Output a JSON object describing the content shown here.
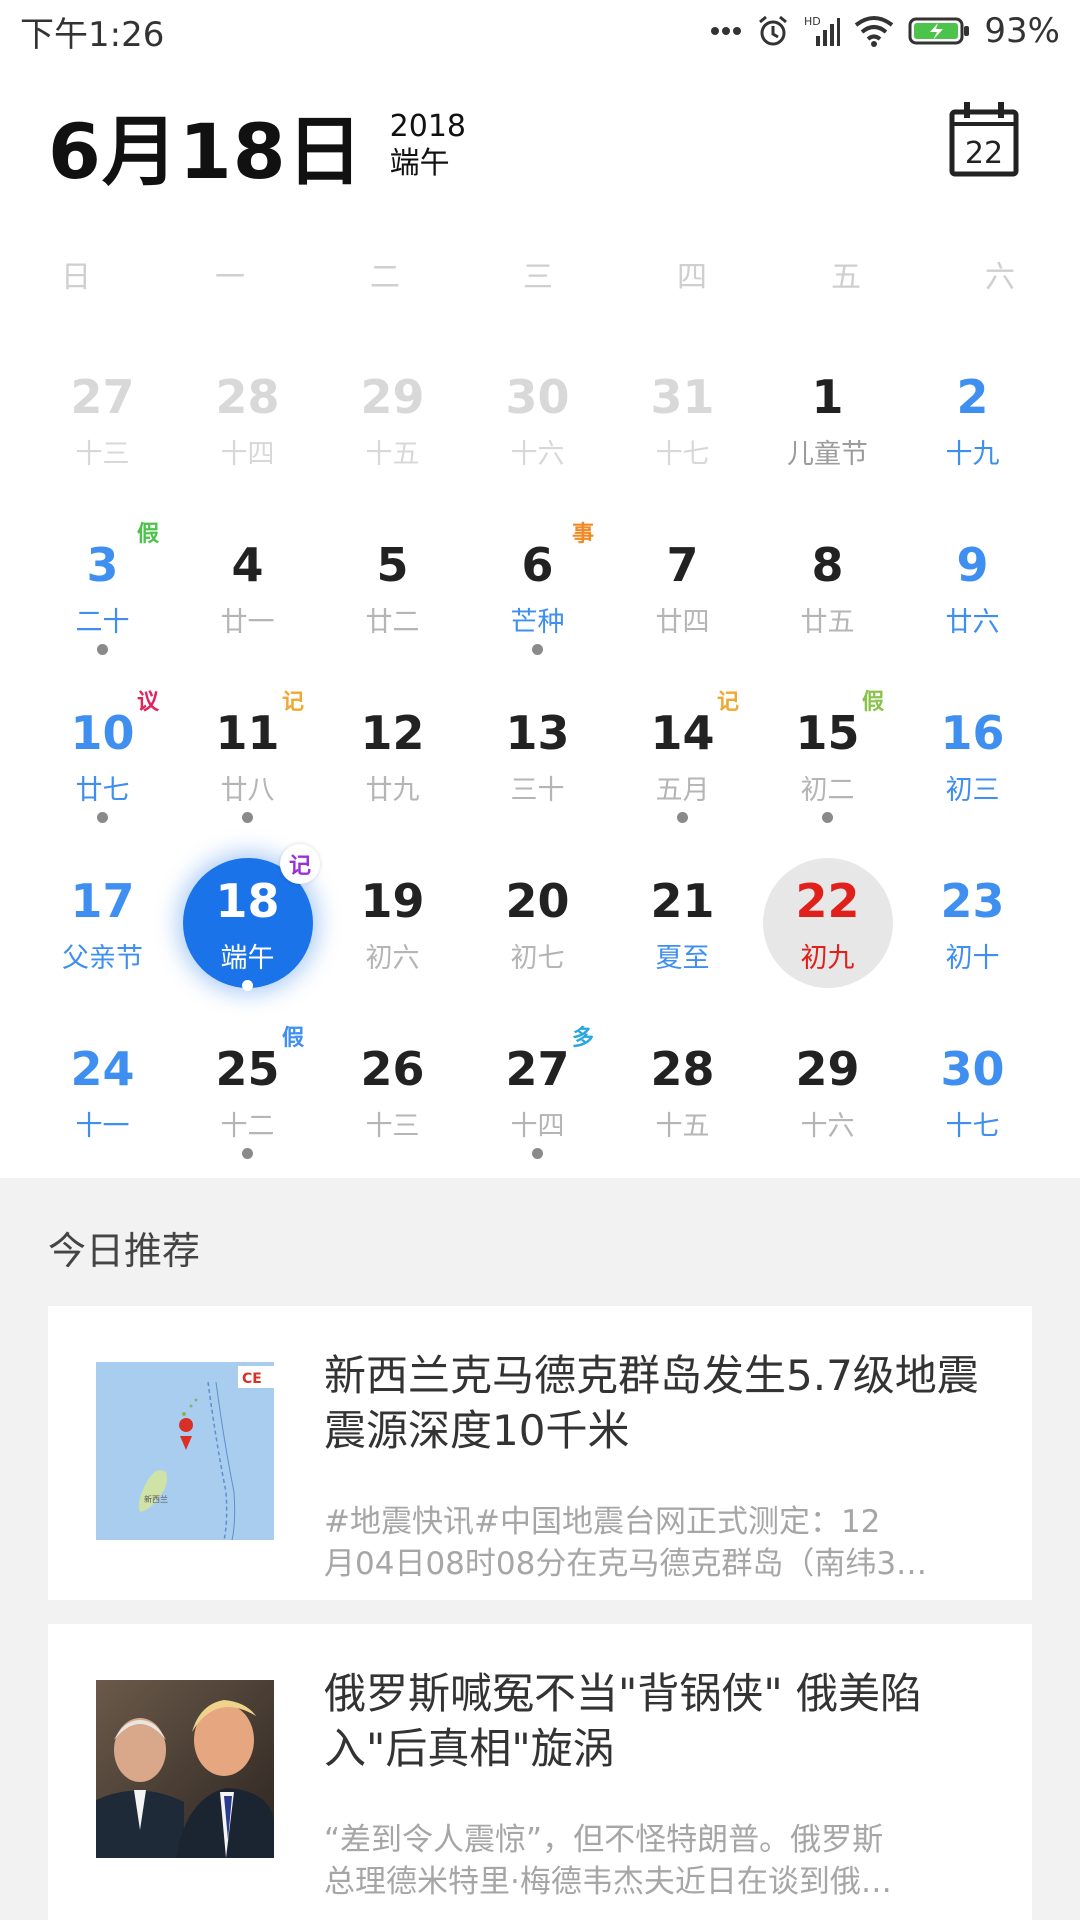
{
  "status_bar": {
    "time": "下午1:26",
    "battery": "93%",
    "icons": [
      "more-dots-icon",
      "alarm-icon",
      "hd-signal-icon",
      "wifi-icon",
      "battery-charging-icon"
    ]
  },
  "header": {
    "date": "6月18日",
    "year": "2018",
    "festival": "端午",
    "today_button_day": "22"
  },
  "weekdays": [
    "日",
    "一",
    "二",
    "三",
    "四",
    "五",
    "六"
  ],
  "calendar": {
    "rows": [
      [
        {
          "day": "27",
          "lunar": "十三",
          "type": "other"
        },
        {
          "day": "28",
          "lunar": "十四",
          "type": "other"
        },
        {
          "day": "29",
          "lunar": "十五",
          "type": "other"
        },
        {
          "day": "30",
          "lunar": "十六",
          "type": "other"
        },
        {
          "day": "31",
          "lunar": "十七",
          "type": "other"
        },
        {
          "day": "1",
          "lunar": "儿童节",
          "type": "holiday-name"
        },
        {
          "day": "2",
          "lunar": "十九",
          "type": "weekend"
        }
      ],
      [
        {
          "day": "3",
          "lunar": "二十",
          "type": "weekend",
          "badge": "假",
          "badge_color": "#4cc34a",
          "dot": true
        },
        {
          "day": "4",
          "lunar": "廿一",
          "type": "normal"
        },
        {
          "day": "5",
          "lunar": "廿二",
          "type": "normal"
        },
        {
          "day": "6",
          "lunar": "芒种",
          "type": "solar",
          "badge": "事",
          "badge_color": "#f08a24",
          "dot": true
        },
        {
          "day": "7",
          "lunar": "廿四",
          "type": "normal"
        },
        {
          "day": "8",
          "lunar": "廿五",
          "type": "normal"
        },
        {
          "day": "9",
          "lunar": "廿六",
          "type": "weekend"
        }
      ],
      [
        {
          "day": "10",
          "lunar": "廿七",
          "type": "weekend",
          "badge": "议",
          "badge_color": "#e0245e",
          "dot": true
        },
        {
          "day": "11",
          "lunar": "廿八",
          "type": "normal",
          "badge": "记",
          "badge_color": "#f0a830",
          "dot": true
        },
        {
          "day": "12",
          "lunar": "廿九",
          "type": "normal"
        },
        {
          "day": "13",
          "lunar": "三十",
          "type": "normal"
        },
        {
          "day": "14",
          "lunar": "五月",
          "type": "normal",
          "badge": "记",
          "badge_color": "#f0a830",
          "dot": true
        },
        {
          "day": "15",
          "lunar": "初二",
          "type": "normal",
          "badge": "假",
          "badge_color": "#8bc34a",
          "dot": true
        },
        {
          "day": "16",
          "lunar": "初三",
          "type": "weekend"
        }
      ],
      [
        {
          "day": "17",
          "lunar": "父亲节",
          "type": "weekend"
        },
        {
          "day": "18",
          "lunar": "端午",
          "type": "selected",
          "badge": "记",
          "badge_color": "#9b30d9",
          "dot": true
        },
        {
          "day": "19",
          "lunar": "初六",
          "type": "normal"
        },
        {
          "day": "20",
          "lunar": "初七",
          "type": "normal"
        },
        {
          "day": "21",
          "lunar": "夏至",
          "type": "solar"
        },
        {
          "day": "22",
          "lunar": "初九",
          "type": "today"
        },
        {
          "day": "23",
          "lunar": "初十",
          "type": "weekend"
        }
      ],
      [
        {
          "day": "24",
          "lunar": "十一",
          "type": "weekend"
        },
        {
          "day": "25",
          "lunar": "十二",
          "type": "normal",
          "badge": "假",
          "badge_color": "#3f8ff0",
          "dot": true
        },
        {
          "day": "26",
          "lunar": "十三",
          "type": "normal"
        },
        {
          "day": "27",
          "lunar": "十四",
          "type": "normal",
          "badge": "多",
          "badge_color": "#2aa7e0",
          "dot": true
        },
        {
          "day": "28",
          "lunar": "十五",
          "type": "normal"
        },
        {
          "day": "29",
          "lunar": "十六",
          "type": "normal"
        },
        {
          "day": "30",
          "lunar": "十七",
          "type": "weekend"
        }
      ]
    ]
  },
  "recommend": {
    "title": "今日推荐",
    "articles": [
      {
        "title": "新西兰克马德克群岛发生5.7级地震 震源深度10千米",
        "summary_line1": "#地震快讯#中国地震台网正式测定：12",
        "summary_line2": "月04日08时08分在克马德克群岛（南纬3…",
        "thumb_caption": "新西兰",
        "thumb_logo": "CE"
      },
      {
        "title": "俄罗斯喊冤不当\"背锅侠\" 俄美陷入\"后真相\"旋涡",
        "summary_line1": "“差到令人震惊”，但不怪特朗普。俄罗斯",
        "summary_line2": "总理德米特里·梅德韦杰夫近日在谈到俄…"
      }
    ]
  },
  "colors": {
    "accent": "#1a73e8",
    "weekend": "#3f8ff0",
    "today": "#e0211b"
  }
}
